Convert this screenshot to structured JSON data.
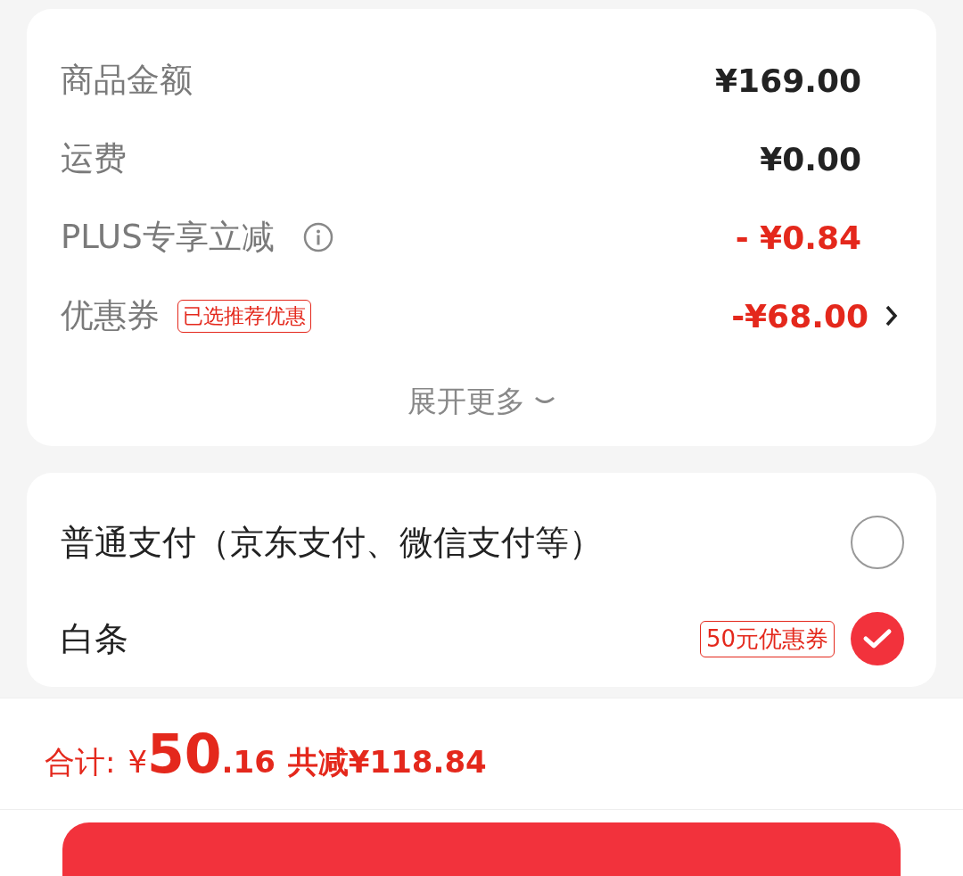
{
  "summary": {
    "rows": [
      {
        "label": "商品金额",
        "value": "¥169.00",
        "kind": "plain",
        "info": false,
        "link": false
      },
      {
        "label": "运费",
        "value": "¥0.00",
        "kind": "plain",
        "info": false,
        "link": false
      },
      {
        "label": "PLUS专享立减",
        "value": "- ¥0.84",
        "kind": "discount",
        "info": true,
        "link": false
      },
      {
        "label": "优惠券",
        "tag": "已选推荐优惠",
        "value": "-¥68.00",
        "kind": "discount",
        "info": false,
        "link": true
      }
    ],
    "expand": "展开更多"
  },
  "payment": {
    "options": [
      {
        "label": "普通支付（京东支付、微信支付等）",
        "selected": false
      },
      {
        "label": "白条",
        "badge": "50元优惠券",
        "selected": true
      }
    ]
  },
  "total": {
    "label": "合计:",
    "currency": "¥",
    "integer": "50",
    "decimal": ".16",
    "saved": "共减¥118.84"
  }
}
